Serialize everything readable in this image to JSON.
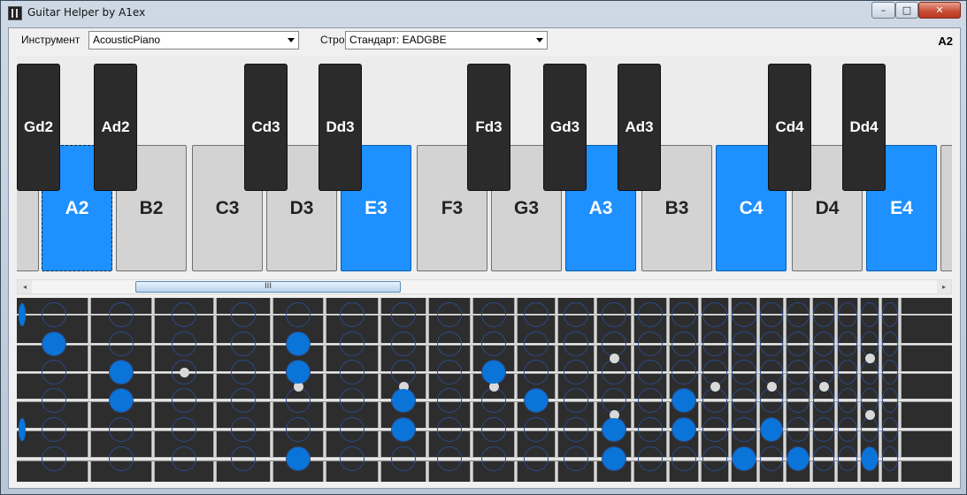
{
  "window": {
    "title": "Guitar Helper by A1ex",
    "min": "–",
    "max": "□",
    "close": "✕"
  },
  "toolbar": {
    "instrument_label": "Инструмент",
    "instrument_value": "AcousticPiano",
    "tuning_label": "Строй",
    "tuning_value": "Стандарт: EADGBE",
    "current_note": "A2"
  },
  "piano": {
    "white_keys": [
      {
        "note": "",
        "active": false
      },
      {
        "note": "A2",
        "active": true,
        "focused": true
      },
      {
        "note": "B2",
        "active": false
      },
      {
        "note": "C3",
        "active": false
      },
      {
        "note": "D3",
        "active": false
      },
      {
        "note": "E3",
        "active": true
      },
      {
        "note": "F3",
        "active": false
      },
      {
        "note": "G3",
        "active": false
      },
      {
        "note": "A3",
        "active": true
      },
      {
        "note": "B3",
        "active": false
      },
      {
        "note": "C4",
        "active": true
      },
      {
        "note": "D4",
        "active": false
      },
      {
        "note": "E4",
        "active": true
      },
      {
        "note": "",
        "active": false
      }
    ],
    "black_keys": [
      "Gd2",
      "Ad2",
      "Cd3",
      "Dd3",
      "Fd3",
      "Gd3",
      "Ad3",
      "Cd4",
      "Dd4"
    ]
  },
  "scrollbar": {
    "left": "◂",
    "right": "▸",
    "grip": "III"
  },
  "fretboard": {
    "strings": 6,
    "frets": 22,
    "marked_notes": [
      {
        "string": 1,
        "fret": 0
      },
      {
        "string": 2,
        "fret": 1
      },
      {
        "string": 2,
        "fret": 5
      },
      {
        "string": 3,
        "fret": 2
      },
      {
        "string": 3,
        "fret": 5
      },
      {
        "string": 3,
        "fret": 9
      },
      {
        "string": 4,
        "fret": 2
      },
      {
        "string": 4,
        "fret": 7
      },
      {
        "string": 4,
        "fret": 10
      },
      {
        "string": 4,
        "fret": 14
      },
      {
        "string": 5,
        "fret": 0
      },
      {
        "string": 5,
        "fret": 7
      },
      {
        "string": 5,
        "fret": 12
      },
      {
        "string": 5,
        "fret": 14
      },
      {
        "string": 5,
        "fret": 17
      },
      {
        "string": 6,
        "fret": 5
      },
      {
        "string": 6,
        "fret": 12
      },
      {
        "string": 6,
        "fret": 16
      },
      {
        "string": 6,
        "fret": 18
      },
      {
        "string": 6,
        "fret": 21
      }
    ],
    "colors": {
      "marker": "#0a74d8",
      "active_key": "#1e90ff"
    }
  }
}
